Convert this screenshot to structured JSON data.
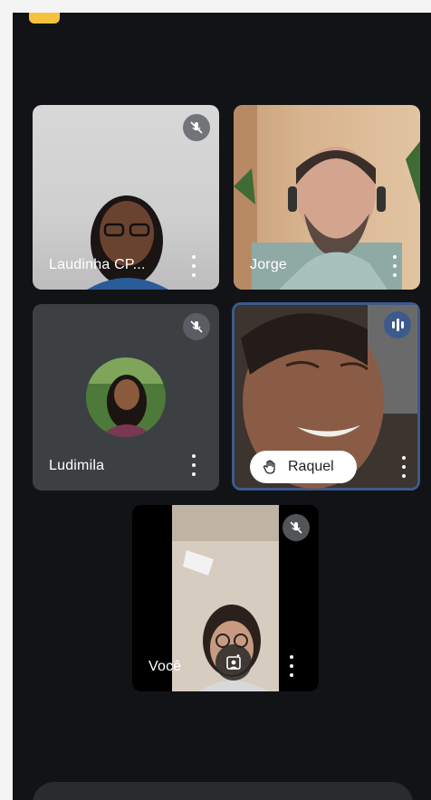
{
  "participants": [
    {
      "name": "Laudinha CP...",
      "muted": true
    },
    {
      "name": "Jorge",
      "muted": false
    },
    {
      "name": "Ludimila",
      "muted": true
    },
    {
      "name": "Raquel",
      "hand_raised": true,
      "speaking": true
    },
    {
      "name": "Você",
      "muted": true
    }
  ],
  "colors": {
    "background": "#121316",
    "tile": "#3c4043",
    "accent": "#8ab4f8",
    "badge": "#f6c23e",
    "active_border": "#3c5a8c"
  },
  "icons": {
    "mute": "mic-off-icon",
    "more": "more-vert-icon",
    "hand": "raised-hand-icon",
    "speaking": "audio-level-icon",
    "effects": "camera-effects-icon"
  }
}
